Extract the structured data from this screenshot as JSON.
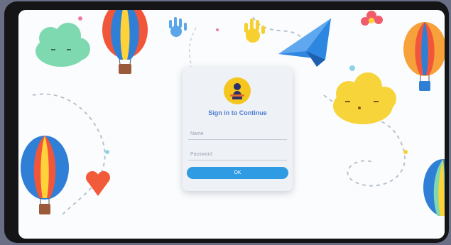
{
  "login": {
    "title": "Sign in to Continue",
    "username_placeholder": "Name",
    "password_placeholder": "Password",
    "submit_label": "OK"
  },
  "colors": {
    "accent": "#2f9be3",
    "title": "#4f7ed2",
    "cloud_yellow": "#f7d43a",
    "cloud_green": "#7fd9b0",
    "paper_plane": "#2d86e0"
  },
  "decorations": [
    "hot-air-balloon",
    "cloud-green",
    "cloud-yellow",
    "paper-plane",
    "hand",
    "heart",
    "dashed-path"
  ]
}
